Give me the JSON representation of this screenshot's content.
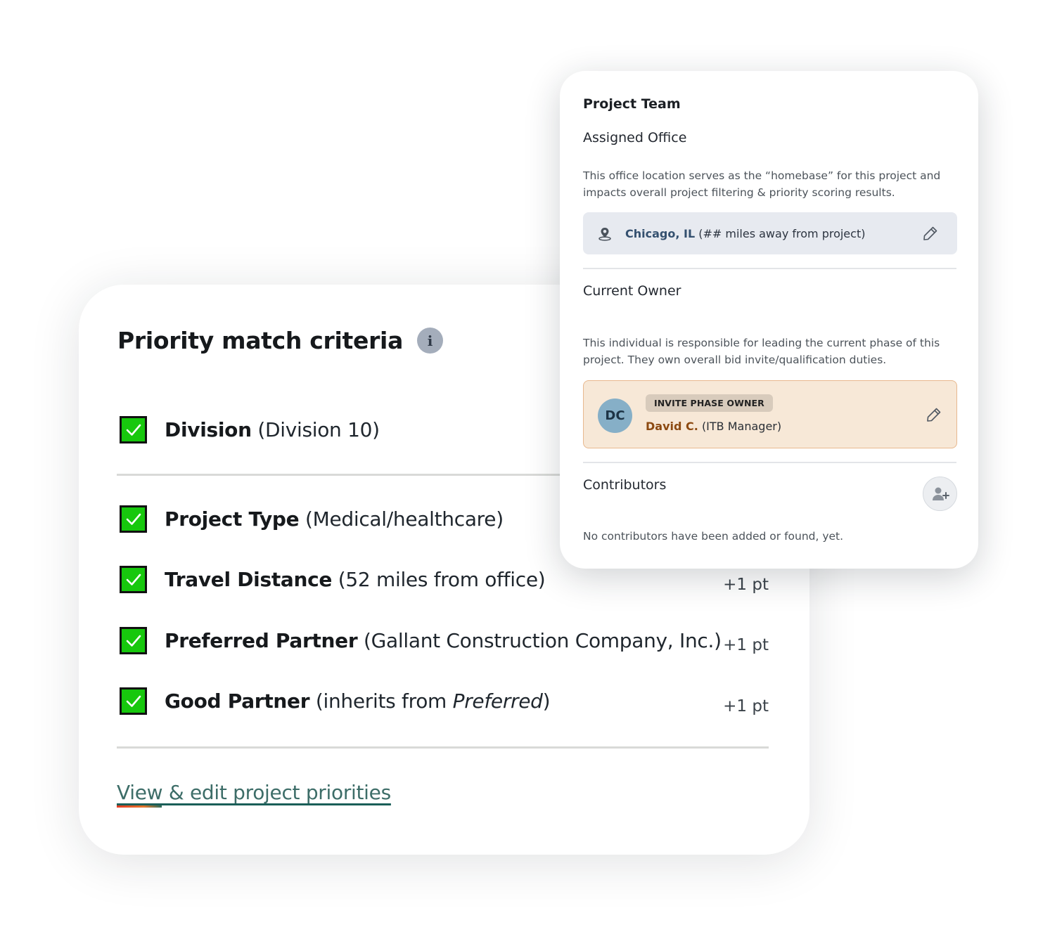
{
  "priority": {
    "title": "Priority match criteria",
    "info_glyph": "i",
    "criteria": [
      {
        "label": "Division",
        "detail": "(Division 10)",
        "points": "",
        "checked": true
      },
      {
        "label": "Project Type",
        "detail": "(Medical/healthcare)",
        "points": "",
        "checked": true
      },
      {
        "label": "Travel Distance",
        "detail": "(52 miles from office)",
        "points": "+1 pt",
        "checked": true
      },
      {
        "label": "Preferred Partner",
        "detail": "(Gallant Construction Company, Inc.)",
        "points": "+1 pt",
        "checked": true
      },
      {
        "label": "Good Partner",
        "detail_pre": "(inherits from ",
        "detail_em": "Preferred",
        "detail_post": ")",
        "points": "+1 pt",
        "checked": true
      }
    ],
    "edit_link": "View & edit project priorities"
  },
  "team": {
    "title": "Project Team",
    "assigned_office": {
      "heading": "Assigned Office",
      "description": "This office location serves as the “homebase” for this project and impacts overall project filtering & priority scoring results.",
      "city": "Chicago, IL",
      "distance": "(## miles away from project)",
      "icon": "map-pin-icon"
    },
    "current_owner": {
      "heading": "Current Owner",
      "description": "This individual is responsible for leading the current phase of this project. They own overall bid invite/qualification duties.",
      "initials": "DC",
      "badge": "INVITE PHASE OWNER",
      "name": "David C.",
      "role": "(ITB Manager)"
    },
    "contributors": {
      "heading": "Contributors",
      "empty_text": "No contributors have been added or found, yet.",
      "add_icon": "add-user-icon"
    }
  },
  "colors": {
    "checkbox_green": "#17c80d",
    "owner_bg": "#f7e8d7",
    "owner_name": "#8c4a12",
    "link_teal": "#1a5e58",
    "office_bg": "#e7eaf0",
    "avatar_bg": "#86afc7"
  }
}
